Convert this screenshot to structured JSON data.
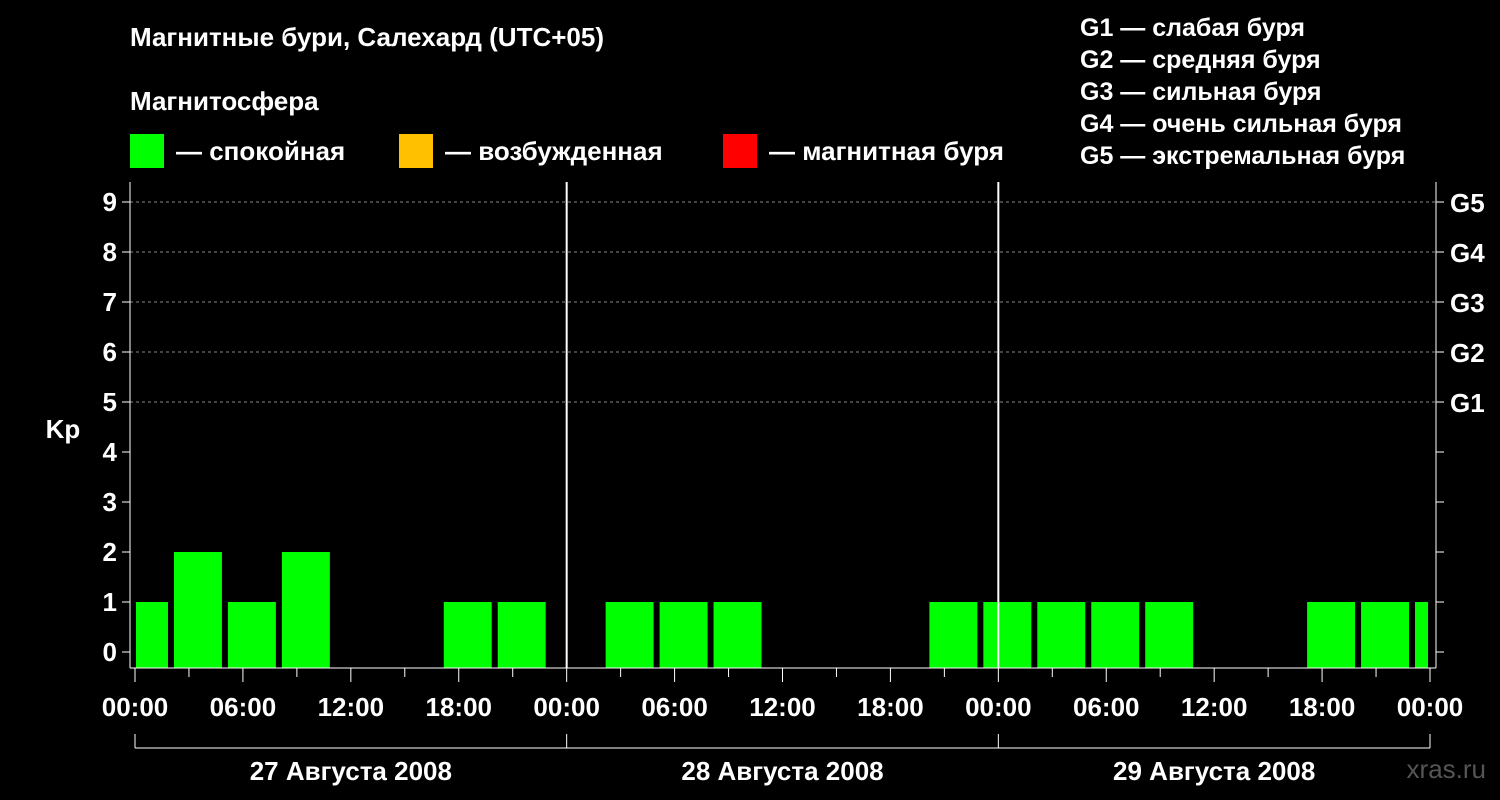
{
  "title": "Магнитные бури, Салехард (UTC+05)",
  "subtitle": "Магнитосфера",
  "legend": [
    {
      "color": "#00ff00",
      "label": "— спокойная"
    },
    {
      "color": "#ffc000",
      "label": "— возбужденная"
    },
    {
      "color": "#ff0000",
      "label": "— магнитная буря"
    }
  ],
  "scale": [
    "G1 — слабая буря",
    "G2 — средняя буря",
    "G3 — сильная буря",
    "G4 — очень сильная буря",
    "G5 — экстремальная буря"
  ],
  "watermark": "xras.ru",
  "chart_data": {
    "type": "bar",
    "ylabel": "Kp",
    "ylim": [
      0,
      9
    ],
    "yticks": [
      "0",
      "1",
      "2",
      "3",
      "4",
      "5",
      "6",
      "7",
      "8",
      "9"
    ],
    "right_ticks": [
      {
        "value": 5,
        "label": "G1"
      },
      {
        "value": 6,
        "label": "G2"
      },
      {
        "value": 7,
        "label": "G3"
      },
      {
        "value": 8,
        "label": "G4"
      },
      {
        "value": 9,
        "label": "G5"
      }
    ],
    "xticks": [
      "00:00",
      "06:00",
      "12:00",
      "18:00",
      "00:00",
      "06:00",
      "12:00",
      "18:00",
      "00:00",
      "06:00",
      "12:00",
      "18:00",
      "00:00"
    ],
    "days": [
      "27 Августа 2008",
      "28 Августа 2008",
      "29 Августа 2008"
    ],
    "interval_hours": 3,
    "first_bar_start_hour": -1,
    "range_hours": 72,
    "bar_color": "#00ff00",
    "values": [
      1,
      2,
      1,
      2,
      0,
      0,
      1,
      1,
      0,
      1,
      1,
      1,
      0,
      0,
      0,
      1,
      1,
      1,
      1,
      1,
      0,
      0,
      1,
      1,
      1
    ],
    "grid": "dashed at 5–9",
    "legend_position": "top"
  }
}
